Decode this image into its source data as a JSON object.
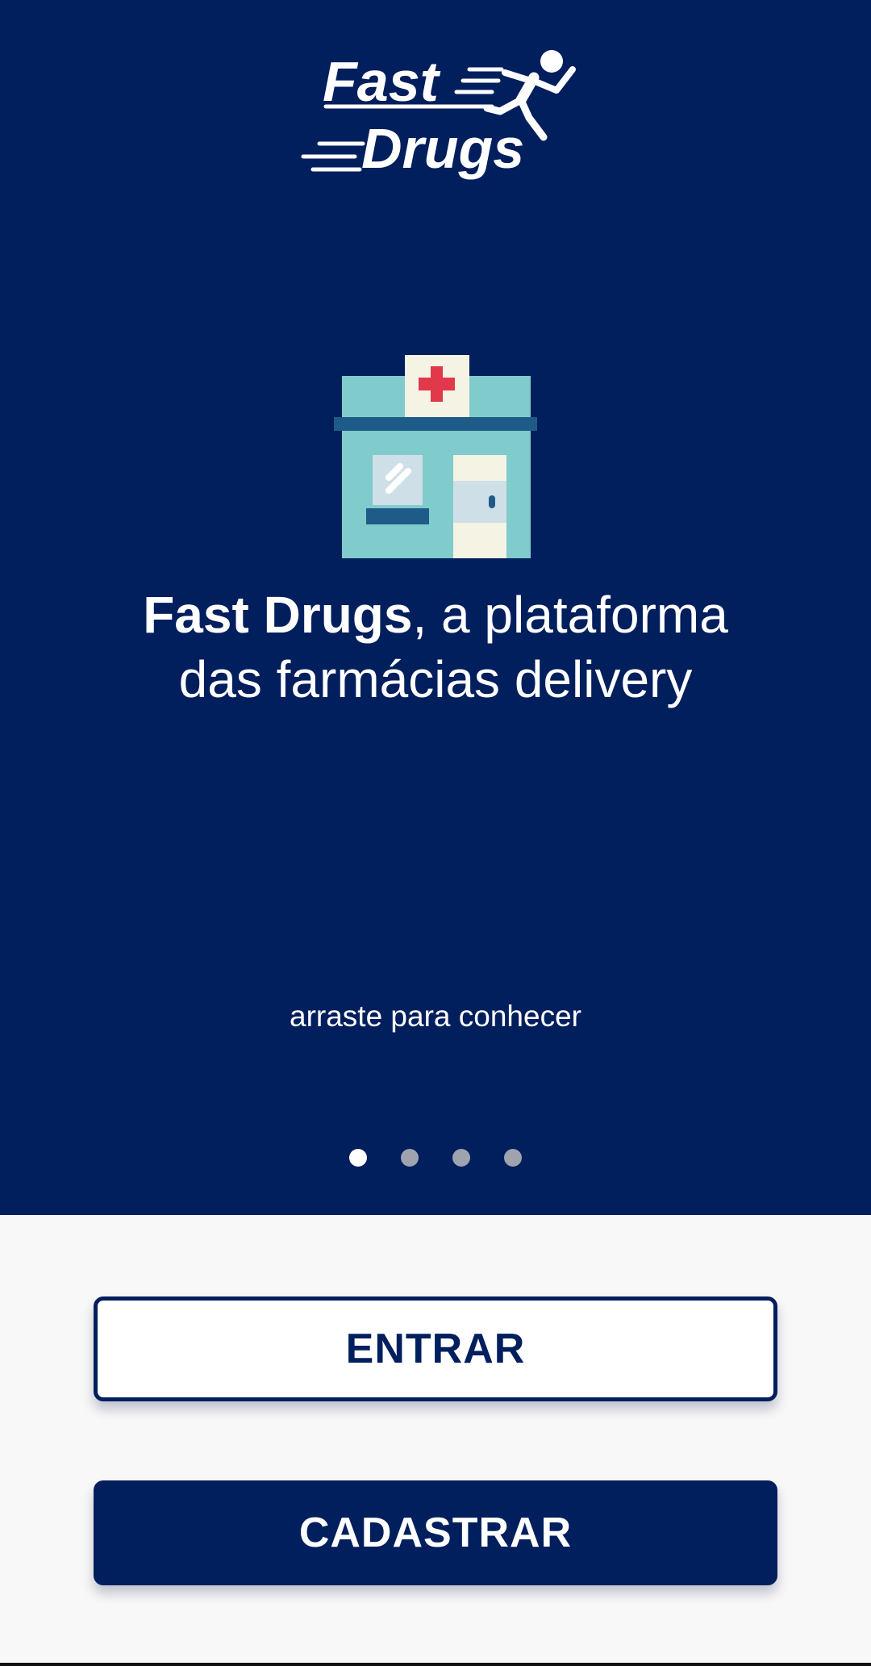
{
  "brand": {
    "logo_line1": "Fast",
    "logo_line2": "Drugs",
    "logo_icon": "running-person-icon",
    "primary_color": "#011e5d"
  },
  "hero": {
    "headline_bold": "Fast Drugs",
    "headline_rest_line1": ", a plataforma",
    "headline_line2": "das farmácias delivery",
    "illustration_icon": "pharmacy-building-icon",
    "swipe_hint": "arraste para conhecer"
  },
  "pager": {
    "total": 4,
    "active_index": 0
  },
  "actions": {
    "login_label": "ENTRAR",
    "signup_label": "CADASTRAR"
  }
}
